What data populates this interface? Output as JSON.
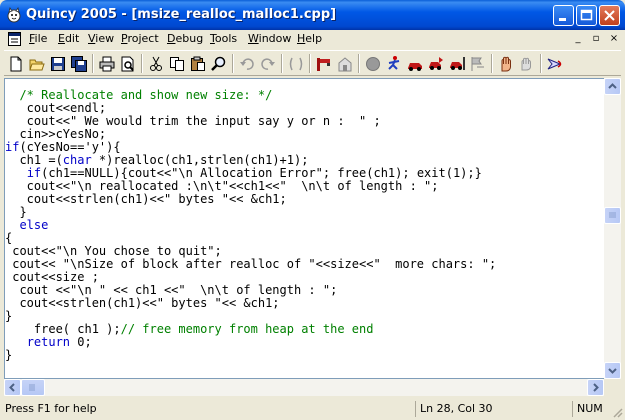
{
  "window": {
    "title": "Quincy 2005 - [msize_realloc_malloc1.cpp]"
  },
  "menu": {
    "items": [
      "File",
      "Edit",
      "View",
      "Project",
      "Debug",
      "Tools",
      "Window",
      "Help"
    ],
    "mdi_controls": [
      "_",
      "▫",
      "×"
    ]
  },
  "toolbar": {
    "icons": [
      "new-file-icon",
      "open-folder-icon",
      "save-icon",
      "save-all-icon",
      "print-icon",
      "print-preview-icon",
      "cut-icon",
      "copy-icon",
      "paste-icon",
      "find-icon",
      "undo-icon",
      "redo-icon",
      "bookmark-icon",
      "compile-icon",
      "build-icon",
      "stop-icon",
      "run-icon",
      "step-icon",
      "step-over-icon",
      "step-out-icon",
      "run-to-cursor-icon",
      "stop-hand-icon",
      "watch-hand-icon",
      "help-icon"
    ]
  },
  "editor": {
    "lines": [
      [
        {
          "t": "  "
        },
        {
          "t": "/* Reallocate and show new size: */",
          "c": "cm"
        }
      ],
      [
        {
          "t": "   cout<<endl;"
        }
      ],
      [
        {
          "t": "   cout<<\" We would trim the input say y or n :  \" ;"
        }
      ],
      [
        {
          "t": "  cin>>cYesNo;"
        }
      ],
      [
        {
          "t": "if",
          "c": "kw"
        },
        {
          "t": "(cYesNo=='y'){"
        }
      ],
      [
        {
          "t": "  ch1 =("
        },
        {
          "t": "char",
          "c": "kw"
        },
        {
          "t": " *)realloc(ch1,strlen(ch1)+1);"
        }
      ],
      [
        {
          "t": "   "
        },
        {
          "t": "if",
          "c": "kw"
        },
        {
          "t": "(ch1==NULL){cout<<\"\\n Allocation Error\"; free(ch1); exit(1);}"
        }
      ],
      [
        {
          "t": "   cout<<\"\\n reallocated :\\n\\t\"<<ch1<<\"  \\n\\t of length : \";"
        }
      ],
      [
        {
          "t": "   cout<<strlen(ch1)<<\" bytes \"<< &ch1;"
        }
      ],
      [
        {
          "t": "  }"
        }
      ],
      [
        {
          "t": "  "
        },
        {
          "t": "else",
          "c": "kw"
        }
      ],
      [
        {
          "t": "{"
        }
      ],
      [
        {
          "t": " cout<<\"\\n You chose to quit\";"
        }
      ],
      [
        {
          "t": " cout<< \"\\nSize of block after realloc of \"<<size<<\"  more chars: \";"
        }
      ],
      [
        {
          "t": " cout<<size ;"
        }
      ],
      [
        {
          "t": "  cout <<\"\\n \" << ch1 <<\"  \\n\\t of length : \";"
        }
      ],
      [
        {
          "t": "  cout<<strlen(ch1)<<\" bytes \"<< &ch1;"
        }
      ],
      [
        {
          "t": "}"
        }
      ],
      [
        {
          "t": "    free( ch1 );"
        },
        {
          "t": "// free memory from heap at the end",
          "c": "cm"
        }
      ],
      [
        {
          "t": "   "
        },
        {
          "t": "return",
          "c": "kw"
        },
        {
          "t": " 0;"
        }
      ],
      [
        {
          "t": "}"
        }
      ]
    ]
  },
  "status": {
    "help": "Press F1 for help",
    "position": "Ln 28, Col 30",
    "num": "NUM"
  },
  "colors": {
    "keyword": "#0000c8",
    "comment": "#008000",
    "titlebar": "#0058e6"
  }
}
